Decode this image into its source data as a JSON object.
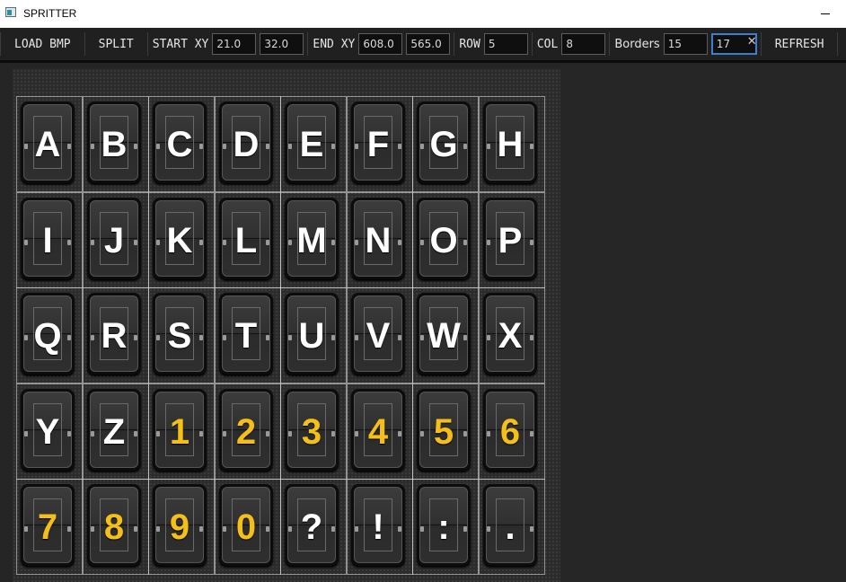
{
  "window": {
    "title": "SPRITTER"
  },
  "toolbar": {
    "load_label": "LOAD BMP",
    "split_label": "SPLIT",
    "start_label": "START XY",
    "start_x": "21.0",
    "start_y": "32.0",
    "end_label": "END XY",
    "end_x": "608.0",
    "end_y": "565.0",
    "row_label": "ROW",
    "row_value": "5",
    "col_label": "COL",
    "col_value": "8",
    "borders_label": "Borders",
    "border_a": "15",
    "border_b": "17",
    "refresh_label": "REFRESH"
  },
  "sprite_sheet": {
    "rows": [
      [
        "A",
        "B",
        "C",
        "D",
        "E",
        "F",
        "G",
        "H"
      ],
      [
        "I",
        "J",
        "K",
        "L",
        "M",
        "N",
        "O",
        "P"
      ],
      [
        "Q",
        "R",
        "S",
        "T",
        "U",
        "V",
        "W",
        "X"
      ],
      [
        "Y",
        "Z",
        "1",
        "2",
        "3",
        "4",
        "5",
        "6"
      ],
      [
        "7",
        "8",
        "9",
        "0",
        "?",
        "!",
        ":",
        "."
      ]
    ],
    "white_color": "#ffffff",
    "yellow_color": "#f4bf18"
  },
  "icons": {
    "clear": "close-x-icon",
    "app": "app-icon",
    "minimize": "minimize-icon"
  }
}
